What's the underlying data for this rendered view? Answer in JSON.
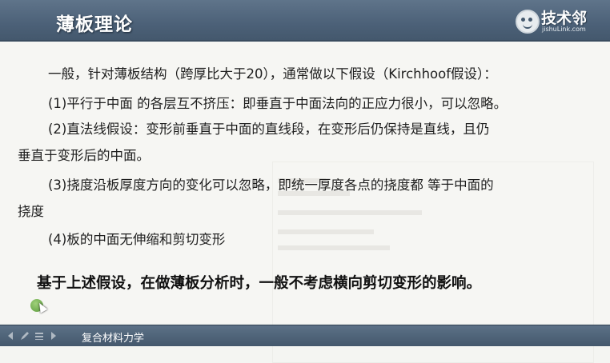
{
  "header": {
    "title": "薄板理论",
    "brand_name": "技术邻",
    "brand_url": "jishuLink.com"
  },
  "body": {
    "lines": [
      "一般，针对薄板结构（跨厚比大于20），通常做以下假设（Kirchhoof假设）：",
      "(1)平行于中面 的各层互不挤压：即垂直于中面法向的正应力很小，可以忽略。",
      "(2)直法线假设：变形前垂直于中面的直线段，在变形后仍保持是直线，且仍",
      "垂直于变形后的中面。",
      "(3)挠度沿板厚度方向的变化可以忽略，即统一厚度各点的挠度都 等于中面的",
      "挠度",
      "(4)板的中面无伸缩和剪切变形"
    ],
    "conclusion": "基于上述假设，在做薄板分析时，一般不考虑横向剪切变形的影响。"
  },
  "footer": {
    "course": "复合材料力学"
  },
  "colors": {
    "header_bg": "#4c6178",
    "content_bg": "#f6f6f3",
    "text": "#1e1e1e"
  }
}
